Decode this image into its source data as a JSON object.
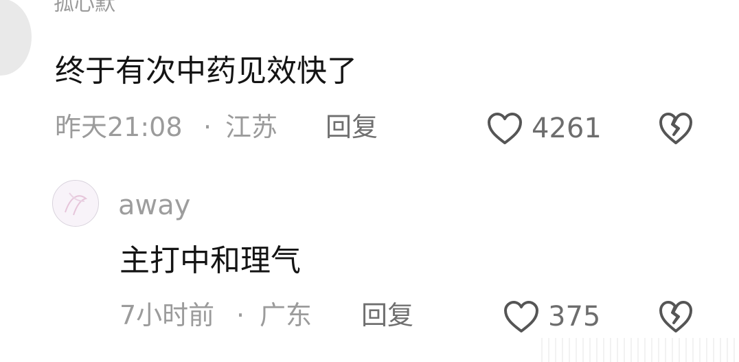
{
  "comment": {
    "username": "孤心默",
    "text": "终于有次中药见效快了",
    "time": "昨天21:08",
    "separator": "·",
    "location": "江苏",
    "reply_label": "回复",
    "like_count": "4261"
  },
  "reply": {
    "username": "away",
    "text": "主打中和理气",
    "time": "7小时前",
    "separator": "·",
    "location": "广东",
    "reply_label": "回复",
    "like_count": "375"
  },
  "icons": {
    "like": "heart-outline-icon",
    "dislike": "broken-heart-icon"
  },
  "colors": {
    "background": "#ffffff",
    "text_primary": "#141414",
    "text_secondary": "#9b9b9b",
    "icon": "#555555"
  }
}
